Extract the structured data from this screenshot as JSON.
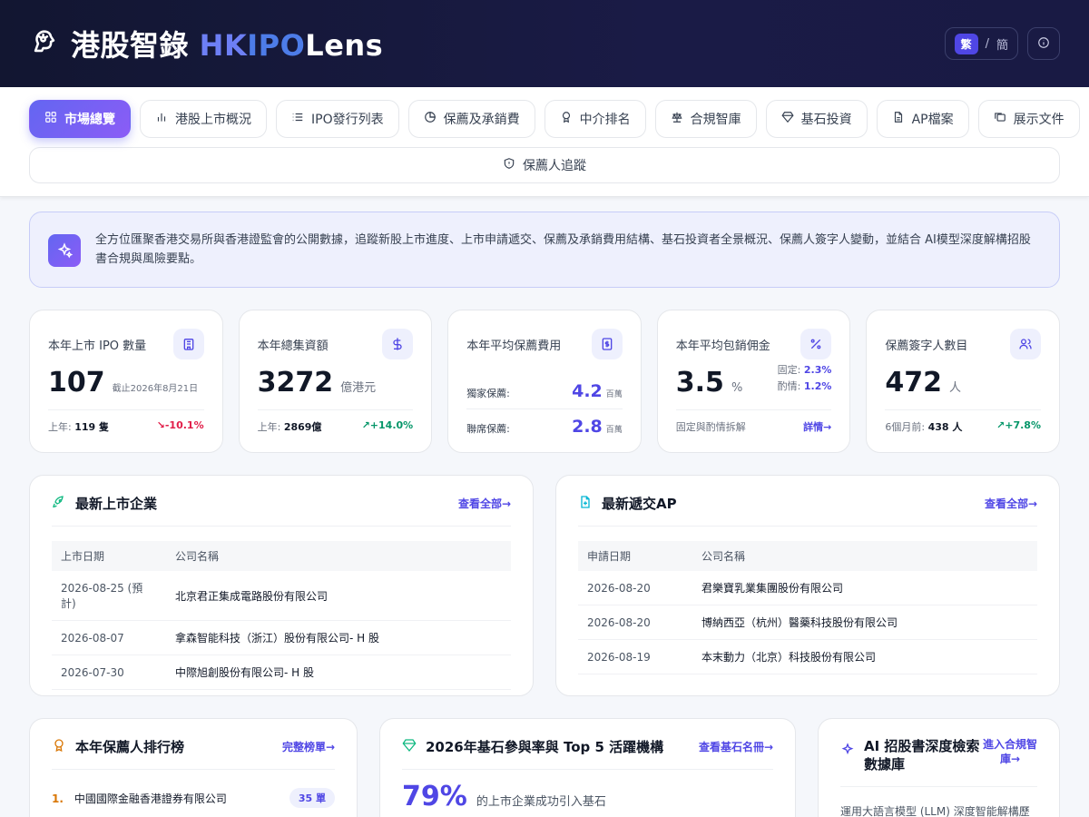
{
  "header": {
    "title_cn": "港股智錄",
    "title_hk": "HK",
    "title_ipo": "IPO",
    "title_lens": "Lens",
    "lang_active": "繁",
    "lang_sep": "/",
    "lang_other": "簡"
  },
  "nav": {
    "tabs": [
      {
        "label": "市場總覽",
        "icon": "grid-icon"
      },
      {
        "label": "港股上市概況",
        "icon": "bar-chart-icon"
      },
      {
        "label": "IPO發行列表",
        "icon": "list-icon"
      },
      {
        "label": "保薦及承銷費",
        "icon": "pie-chart-icon"
      },
      {
        "label": "中介排名",
        "icon": "award-icon"
      },
      {
        "label": "合規智庫",
        "icon": "scale-icon"
      },
      {
        "label": "基石投資",
        "icon": "gem-icon"
      },
      {
        "label": "AP檔案",
        "icon": "file-icon"
      },
      {
        "label": "展示文件",
        "icon": "folders-icon"
      }
    ],
    "second_row": "保薦人追蹤"
  },
  "banner": {
    "text": "全方位匯聚香港交易所與香港證監會的公開數據，追蹤新股上市進度、上市申請遞交、保薦及承銷費用結構、基石投資者全景概況、保薦人簽字人變動，並結合 AI模型深度解構招股書合規與風險要點。"
  },
  "stats": {
    "ipo_count": {
      "title": "本年上市 IPO 數量",
      "value": "107",
      "sub": "截止2026年8月21日",
      "foot_label": "上年:",
      "foot_value": "119 隻",
      "change": "-10.1%"
    },
    "raised": {
      "title": "本年總集資額",
      "value": "3272",
      "unit": "億港元",
      "foot_label": "上年:",
      "foot_value": "2869億",
      "change": "+14.0%"
    },
    "sponsor_fee": {
      "title": "本年平均保薦費用",
      "sole_label": "獨家保薦:",
      "sole_value": "4.2",
      "sole_unit": "百萬",
      "joint_label": "聯席保薦:",
      "joint_value": "2.8",
      "joint_unit": "百萬"
    },
    "commission": {
      "title": "本年平均包銷佣金",
      "value": "3.5",
      "unit": "%",
      "fixed_label": "固定:",
      "fixed_value": "2.3%",
      "disc_label": "酌情:",
      "disc_value": "1.2%",
      "foot_label": "固定與酌情拆解",
      "foot_link": "詳情→"
    },
    "signers": {
      "title": "保薦簽字人數目",
      "value": "472",
      "unit": "人",
      "foot_label": "6個月前:",
      "foot_value": "438 人",
      "change": "+7.8%"
    }
  },
  "latest_listings": {
    "title": "最新上市企業",
    "link": "查看全部→",
    "columns": [
      "上市日期",
      "公司名稱"
    ],
    "rows": [
      {
        "date": "2026-08-25 (預計)",
        "name": "北京君正集成電路股份有限公司"
      },
      {
        "date": "2026-08-07",
        "name": "拿森智能科技（浙江）股份有限公司- H 股"
      },
      {
        "date": "2026-07-30",
        "name": "中際旭創股份有限公司- H 股"
      }
    ]
  },
  "latest_ap": {
    "title": "最新遞交AP",
    "link": "查看全部→",
    "columns": [
      "申請日期",
      "公司名稱"
    ],
    "rows": [
      {
        "date": "2026-08-20",
        "name": "君樂寶乳業集團股份有限公司"
      },
      {
        "date": "2026-08-20",
        "name": "博納西亞（杭州）醫藥科技股份有限公司"
      },
      {
        "date": "2026-08-19",
        "name": "本末動力（北京）科技股份有限公司"
      }
    ]
  },
  "sponsor_rank": {
    "title": "本年保薦人排行榜",
    "link": "完整榜單→",
    "first_no": "1.",
    "first_name": "中國國際金融香港證券有限公司",
    "first_count": "35 單"
  },
  "cornerstone": {
    "title": "2026年基石參與率與 Top 5 活躍機構",
    "link": "查看基石名冊→",
    "pct": "79%",
    "pct_text": "的上市企業成功引入基石"
  },
  "ai_db": {
    "title_line1": "AI 招股書深度檢索",
    "title_line2": "數據庫",
    "link_line1": "進入合規智",
    "link_line2": "庫→",
    "desc": "運用大語言模型 (LLM) 深度智能解構歷"
  },
  "colors": {
    "accent": "#4f46e5",
    "header_bg": "#121631",
    "negative": "#e11d48",
    "positive": "#059669"
  }
}
